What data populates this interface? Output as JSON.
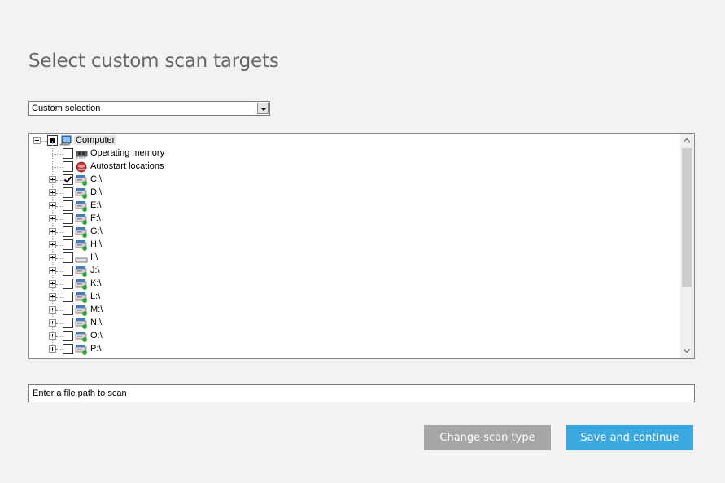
{
  "page": {
    "title": "Select custom scan targets"
  },
  "scan_type_select": {
    "value": "Custom selection"
  },
  "tree": {
    "root": {
      "label": "Computer",
      "state": "partial",
      "icon": "computer-icon"
    },
    "items": [
      {
        "label": "Operating memory",
        "state": "unchecked",
        "icon": "memory-chip-icon",
        "expandable": false
      },
      {
        "label": "Autostart locations",
        "state": "unchecked",
        "icon": "autostart-icon",
        "expandable": false
      },
      {
        "label": "C:\\",
        "state": "checked",
        "icon": "network-drive-icon",
        "expandable": true
      },
      {
        "label": "D:\\",
        "state": "unchecked",
        "icon": "network-drive-icon",
        "expandable": true
      },
      {
        "label": "E:\\",
        "state": "unchecked",
        "icon": "network-drive-icon",
        "expandable": true
      },
      {
        "label": "F:\\",
        "state": "unchecked",
        "icon": "network-drive-icon",
        "expandable": true
      },
      {
        "label": "G:\\",
        "state": "unchecked",
        "icon": "network-drive-icon",
        "expandable": true
      },
      {
        "label": "H:\\",
        "state": "unchecked",
        "icon": "network-drive-icon",
        "expandable": true
      },
      {
        "label": "I:\\",
        "state": "unchecked",
        "icon": "local-drive-icon",
        "expandable": true
      },
      {
        "label": "J:\\",
        "state": "unchecked",
        "icon": "network-drive-icon",
        "expandable": true
      },
      {
        "label": "K:\\",
        "state": "unchecked",
        "icon": "network-drive-icon",
        "expandable": true
      },
      {
        "label": "L:\\",
        "state": "unchecked",
        "icon": "network-drive-icon",
        "expandable": true
      },
      {
        "label": "M:\\",
        "state": "unchecked",
        "icon": "network-drive-icon",
        "expandable": true
      },
      {
        "label": "N:\\",
        "state": "unchecked",
        "icon": "network-drive-icon",
        "expandable": true
      },
      {
        "label": "O:\\",
        "state": "unchecked",
        "icon": "network-drive-icon",
        "expandable": true
      },
      {
        "label": "P:\\",
        "state": "unchecked",
        "icon": "network-drive-icon",
        "expandable": true
      }
    ]
  },
  "path_input": {
    "value": "Enter a file path to scan"
  },
  "buttons": {
    "change_scan_type": "Change scan type",
    "save_and_continue": "Save and continue"
  },
  "colors": {
    "primary_button": "#3ba8e0",
    "secondary_button": "#a6a6a6",
    "background": "#f2f2f2"
  }
}
